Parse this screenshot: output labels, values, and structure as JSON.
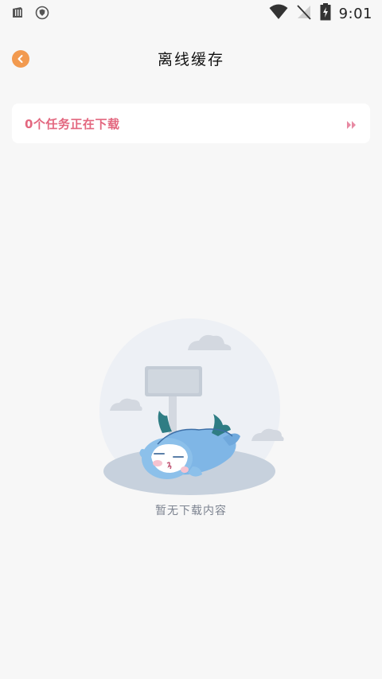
{
  "status_bar": {
    "time": "9:01",
    "icons": [
      "sim-card-icon",
      "shield-icon",
      "wifi-icon",
      "no-signal-icon",
      "battery-charging-icon"
    ]
  },
  "header": {
    "title": "离线缓存",
    "back_icon": "chevron-left-icon",
    "accent_color": "#f29a4f"
  },
  "download_card": {
    "label": "0个任务正在下载",
    "icon": "double-chevron-right-icon",
    "label_color": "#e3677f"
  },
  "empty_state": {
    "illustration": "sleeping-dragon-illustration",
    "text": "暂无下载内容"
  }
}
